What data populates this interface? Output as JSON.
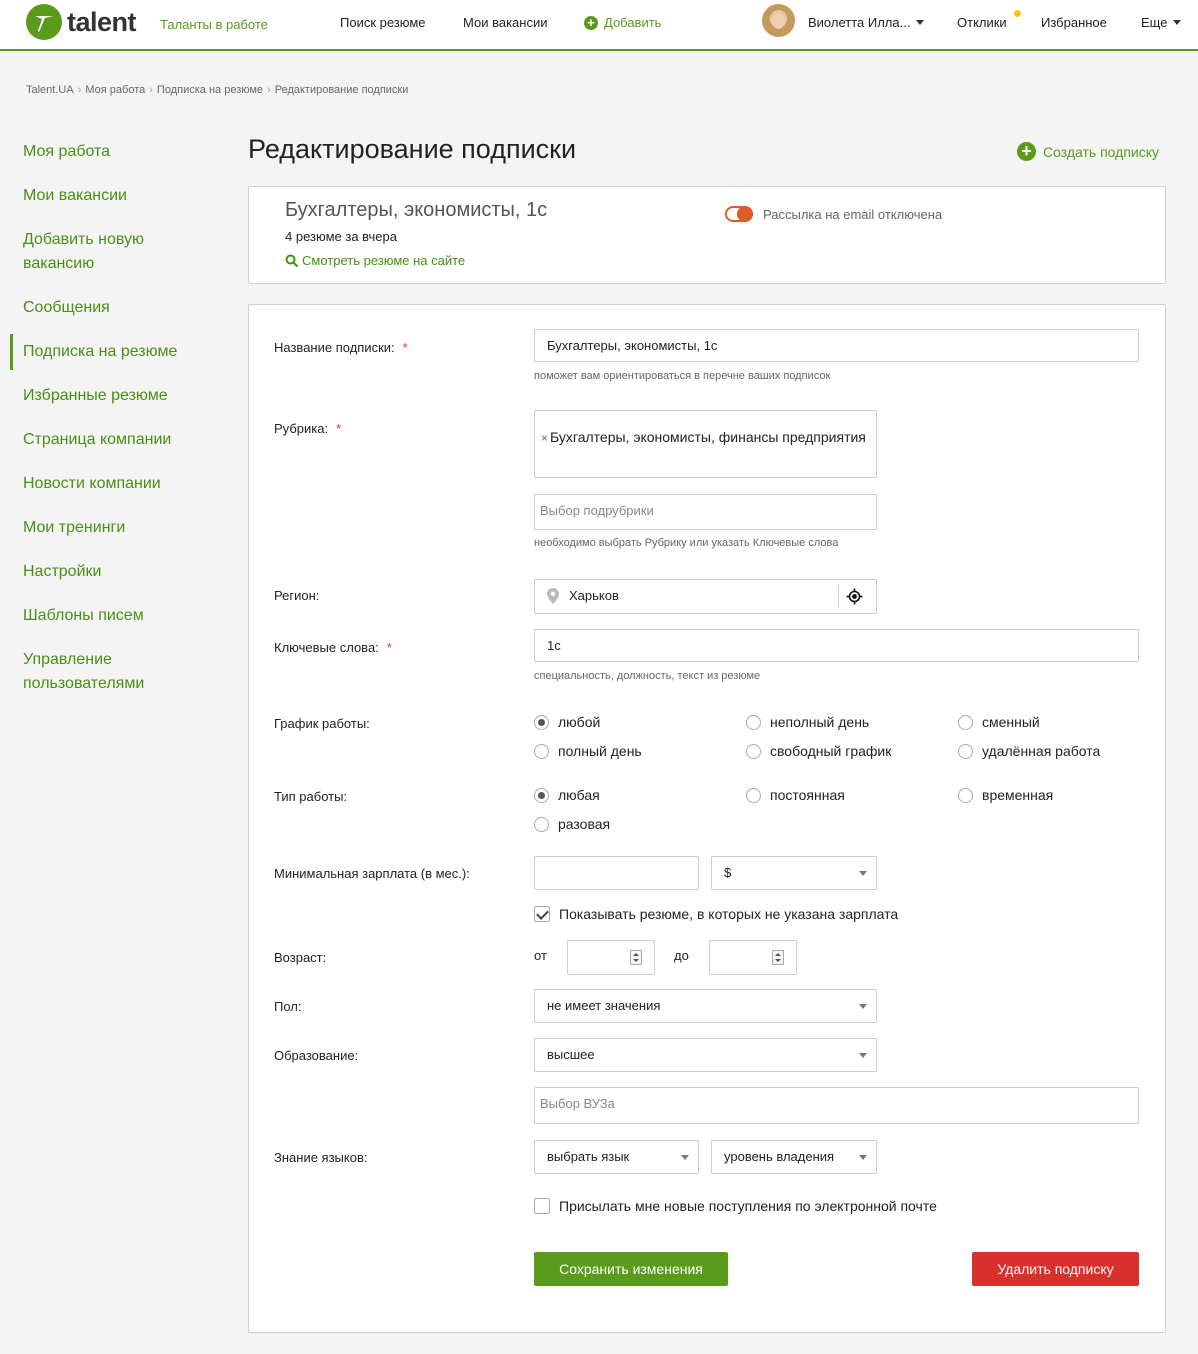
{
  "header": {
    "logo": "talent",
    "tagline": "Таланты в работе",
    "nav": [
      "Поиск резюме",
      "Мои вакансии"
    ],
    "add": "Добавить",
    "user": "Виолетта Илла...",
    "responses": "Отклики",
    "favorites": "Избранное",
    "more": "Еще"
  },
  "breadcrumb": [
    "Talent.UA",
    "Моя работа",
    "Подписка на резюме",
    "Редактирование подписки"
  ],
  "sidebar": {
    "items": [
      "Моя работа",
      "Мои вакансии",
      "Добавить новую вакансию",
      "Сообщения",
      "Подписка на резюме",
      "Избранные резюме",
      "Страница компании",
      "Новости компании",
      "Мои тренинги",
      "Настройки",
      "Шаблоны писем",
      "Управление пользователями"
    ]
  },
  "page": {
    "title": "Редактирование подписки",
    "create": "Создать подписку"
  },
  "summary": {
    "title": "Бухгалтеры, экономисты, 1с",
    "count": "4 резюме за вчера",
    "view": "Смотреть резюме на сайте",
    "email_toggle": "Рассылка на email отключена"
  },
  "form": {
    "name_label": "Название подписки:",
    "name_value": "Бухгалтеры, экономисты, 1с",
    "name_hint": "поможет вам ориентироваться в перечне ваших подписок",
    "rubric_label": "Рубрика:",
    "rubric_tag": "Бухгалтеры, экономисты, финансы предприятия",
    "subrubric_placeholder": "Выбор подрубрики",
    "rubric_hint": "необходимо выбрать Рубрику или указать Ключевые слова",
    "region_label": "Регион:",
    "region_value": "Харьков",
    "keywords_label": "Ключевые слова:",
    "keywords_value": "1с",
    "keywords_hint": "специальность, должность, текст из резюме",
    "schedule_label": "График работы:",
    "schedule": [
      "любой",
      "неполный день",
      "сменный",
      "полный день",
      "свободный график",
      "удалённая работа"
    ],
    "type_label": "Тип работы:",
    "type": [
      "любая",
      "постоянная",
      "временная",
      "разовая"
    ],
    "salary_label": "Минимальная зарплата (в мес.):",
    "salary_value": "",
    "currency": "$",
    "show_no_salary": "Показывать резюме, в которых не указана зарплата",
    "age_label": "Возраст:",
    "age_from": "от",
    "age_to": "до",
    "gender_label": "Пол:",
    "gender_value": "не имеет значения",
    "education_label": "Образование:",
    "education_value": "высшее",
    "university_placeholder": "Выбор ВУЗа",
    "languages_label": "Знание языков:",
    "language_value": "выбрать язык",
    "level_value": "уровень владения",
    "send_new": "Присылать мне новые поступления по электронной почте",
    "save": "Сохранить изменения",
    "delete": "Удалить подписку"
  },
  "colors": {
    "brand": "#5a9b1c",
    "delete": "#d8302c",
    "toggle_off": "#e05a2b"
  }
}
